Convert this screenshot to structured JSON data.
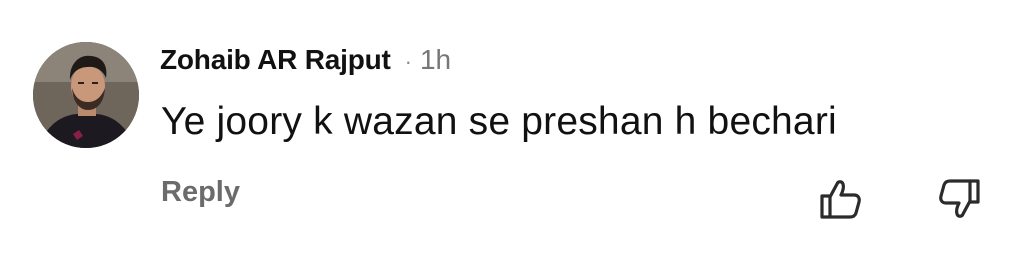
{
  "comment": {
    "author": "Zohaib AR Rajput",
    "separator": "·",
    "time": "1h",
    "text": "Ye joory k wazan se preshan h bechari",
    "reply_label": "Reply"
  },
  "icons": {
    "avatar": "user-avatar-photo",
    "like": "thumbs-up-icon",
    "dislike": "thumbs-down-icon"
  },
  "colors": {
    "author": "#111111",
    "meta": "#777777",
    "reply": "#6b6b6b",
    "icon_stroke": "#2b2b2b"
  }
}
